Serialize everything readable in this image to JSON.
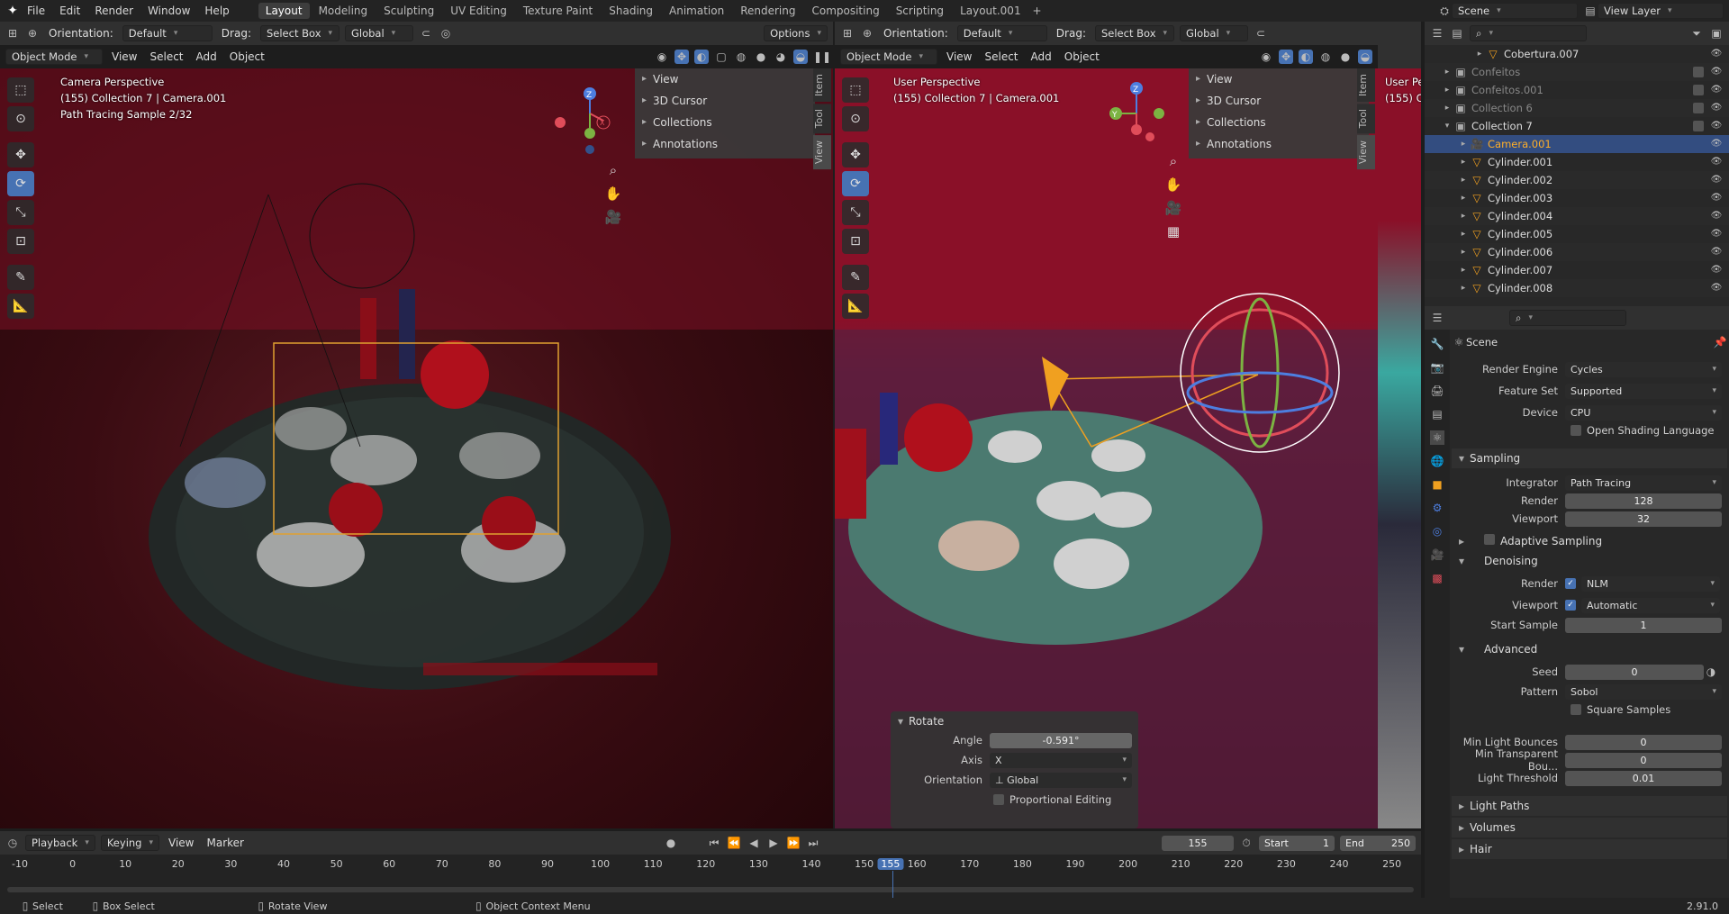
{
  "topbar": {
    "menus": [
      "File",
      "Edit",
      "Render",
      "Window",
      "Help"
    ],
    "workspaces": [
      "Layout",
      "Modeling",
      "Sculpting",
      "UV Editing",
      "Texture Paint",
      "Shading",
      "Animation",
      "Rendering",
      "Compositing",
      "Scripting",
      "Layout.001"
    ],
    "active_workspace": "Layout",
    "scene": "Scene",
    "view_layer": "View Layer"
  },
  "left_view": {
    "orientation_label": "Orientation:",
    "orientation": "Default",
    "drag_label": "Drag:",
    "drag": "Select Box",
    "transform_space": "Global",
    "options": "Options",
    "mode": "Object Mode",
    "menus": [
      "View",
      "Select",
      "Add",
      "Object"
    ],
    "overlay": [
      "Camera Perspective",
      "(155) Collection 7 | Camera.001",
      "Path Tracing Sample 2/32"
    ],
    "npanel": [
      "View",
      "3D Cursor",
      "Collections",
      "Annotations"
    ],
    "tabs": [
      "Item",
      "Tool",
      "View"
    ]
  },
  "right_view": {
    "orientation_label": "Orientation:",
    "orientation": "Default",
    "drag_label": "Drag:",
    "drag": "Select Box",
    "transform_space": "Global",
    "mode": "Object Mode",
    "menus": [
      "View",
      "Select",
      "Add",
      "Object"
    ],
    "overlay": [
      "User Perspective",
      "(155) Collection 7 | Camera.001"
    ],
    "npanel": [
      "View",
      "3D Cursor",
      "Collections",
      "Annotations"
    ],
    "tabs": [
      "Item",
      "Tool",
      "View"
    ],
    "third_overlay": [
      "User Persp",
      "(155) Co"
    ]
  },
  "rotate_panel": {
    "title": "Rotate",
    "angle_label": "Angle",
    "angle": "-0.591°",
    "axis_label": "Axis",
    "axis": "X",
    "orientation_label": "Orientation",
    "orientation": "Global",
    "proportional": "Proportional Editing"
  },
  "outliner": {
    "rows": [
      {
        "name": "Cobertura.007",
        "indent": 3,
        "kind": "mesh",
        "dim": false
      },
      {
        "name": "Confeitos",
        "indent": 1,
        "kind": "coll",
        "dim": true
      },
      {
        "name": "Confeitos.001",
        "indent": 1,
        "kind": "coll",
        "dim": true
      },
      {
        "name": "Collection 6",
        "indent": 1,
        "kind": "coll",
        "dim": true
      },
      {
        "name": "Collection 7",
        "indent": 1,
        "kind": "coll",
        "dim": false
      },
      {
        "name": "Camera.001",
        "indent": 2,
        "kind": "camera",
        "dim": false,
        "sel": true
      },
      {
        "name": "Cylinder.001",
        "indent": 2,
        "kind": "mesh",
        "dim": false
      },
      {
        "name": "Cylinder.002",
        "indent": 2,
        "kind": "mesh",
        "dim": false
      },
      {
        "name": "Cylinder.003",
        "indent": 2,
        "kind": "mesh",
        "dim": false
      },
      {
        "name": "Cylinder.004",
        "indent": 2,
        "kind": "mesh",
        "dim": false
      },
      {
        "name": "Cylinder.005",
        "indent": 2,
        "kind": "mesh",
        "dim": false
      },
      {
        "name": "Cylinder.006",
        "indent": 2,
        "kind": "mesh",
        "dim": false
      },
      {
        "name": "Cylinder.007",
        "indent": 2,
        "kind": "mesh",
        "dim": false
      },
      {
        "name": "Cylinder.008",
        "indent": 2,
        "kind": "mesh",
        "dim": false
      }
    ]
  },
  "properties": {
    "context": "Scene",
    "render_engine_label": "Render Engine",
    "render_engine": "Cycles",
    "feature_set_label": "Feature Set",
    "feature_set": "Supported",
    "device_label": "Device",
    "device": "CPU",
    "osl": "Open Shading Language",
    "sampling": "Sampling",
    "integrator_label": "Integrator",
    "integrator": "Path Tracing",
    "render_label": "Render",
    "render": "128",
    "viewport_label": "Viewport",
    "viewport": "32",
    "adaptive": "Adaptive Sampling",
    "denoising": "Denoising",
    "dn_render_label": "Render",
    "dn_render": "NLM",
    "dn_viewport_label": "Viewport",
    "dn_viewport": "Automatic",
    "start_sample_label": "Start Sample",
    "start_sample": "1",
    "advanced": "Advanced",
    "seed_label": "Seed",
    "seed": "0",
    "pattern_label": "Pattern",
    "pattern": "Sobol",
    "square": "Square Samples",
    "min_light_label": "Min Light Bounces",
    "min_light": "0",
    "min_trans_label": "Min Transparent Bou...",
    "min_trans": "0",
    "light_thr_label": "Light Threshold",
    "light_thr": "0.01",
    "light_paths": "Light Paths",
    "volumes": "Volumes",
    "hair": "Hair"
  },
  "timeline": {
    "menus": [
      "Playback",
      "Keying",
      "View",
      "Marker"
    ],
    "current": "155",
    "start_label": "Start",
    "start": "1",
    "end_label": "End",
    "end": "250",
    "ticks": [
      "-10",
      "0",
      "10",
      "20",
      "30",
      "40",
      "50",
      "60",
      "70",
      "80",
      "90",
      "100",
      "110",
      "120",
      "130",
      "140",
      "150",
      "155",
      "160",
      "170",
      "180",
      "190",
      "200",
      "210",
      "220",
      "230",
      "240",
      "250"
    ]
  },
  "statusbar": {
    "items": [
      "Select",
      "Box Select",
      "Rotate View",
      "Object Context Menu"
    ],
    "version": "2.91.0"
  },
  "colors": {
    "accent": "#4772b3",
    "selected_text": "#ffaf29",
    "header": "#303030"
  }
}
